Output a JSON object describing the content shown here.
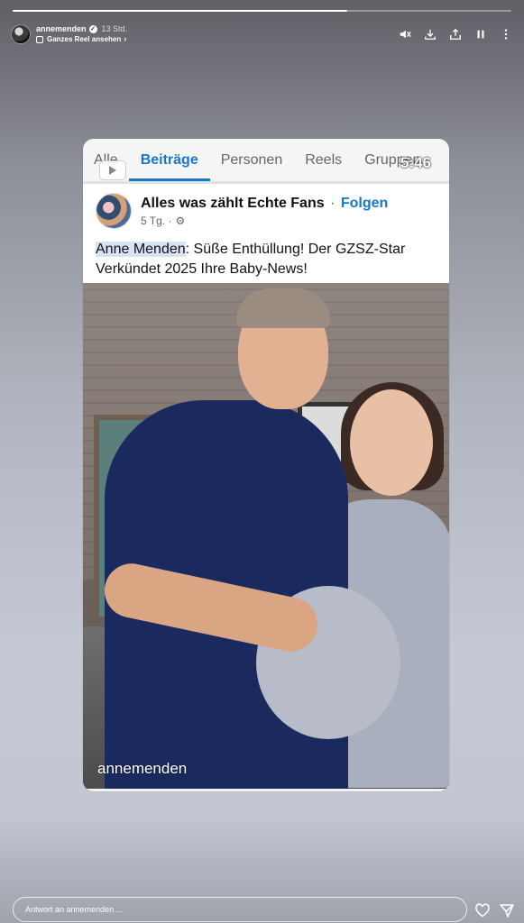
{
  "story": {
    "progress": 0.67
  },
  "header": {
    "username": "annemenden",
    "verified_mark": "✓",
    "time_ago": "13 Std.",
    "reel_link": "Ganzes Reel ansehen",
    "chevron": "›",
    "icons": [
      "mute-icon",
      "download-icon",
      "share-icon",
      "pause-icon",
      "more-icon"
    ]
  },
  "card": {
    "tabs": [
      {
        "label": "Alle"
      },
      {
        "label": "Beiträge"
      },
      {
        "label": "Personen"
      },
      {
        "label": "Reels"
      },
      {
        "label": "Gruppen"
      }
    ],
    "active_tab": "Beiträge",
    "counter": "5:46",
    "post": {
      "page_name": "Alles was zählt Echte Fans",
      "separator": "·",
      "follow": "Folgen",
      "meta": "5 Tg. ·",
      "text_highlight": "Anne Menden",
      "text_rest": ": Süße Enthüllung! Der GZSZ-Star Verkündet 2025 Ihre Baby-News!"
    },
    "photo_watermark": "annemenden"
  },
  "reply": {
    "placeholder": "Antwort an annemenden ..."
  },
  "colors": {
    "accent": "#1877c9"
  }
}
